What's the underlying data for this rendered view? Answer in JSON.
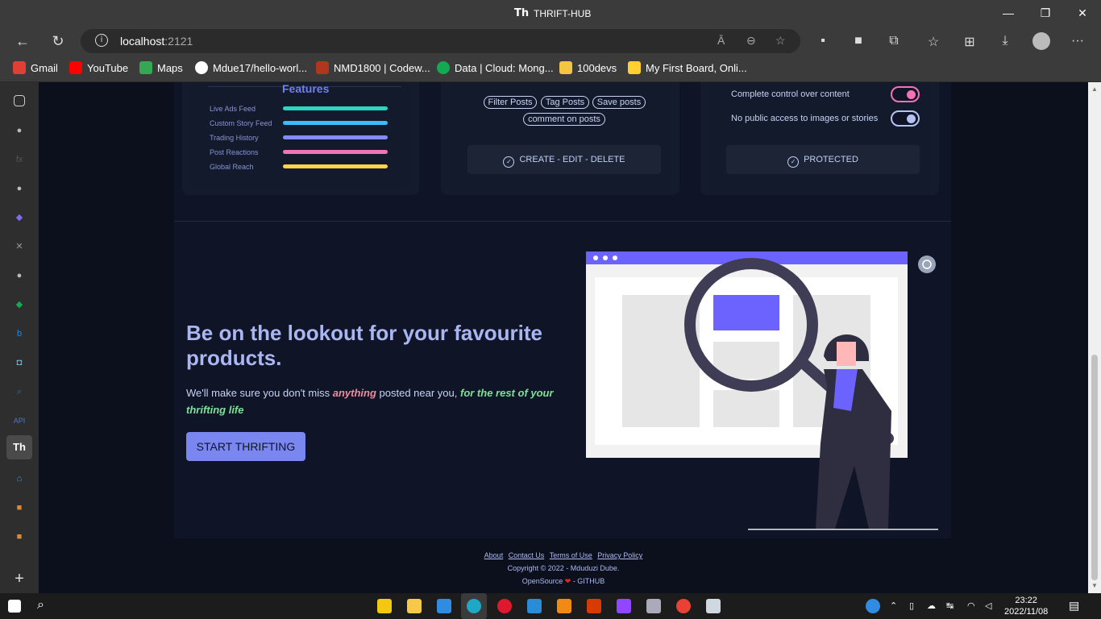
{
  "window": {
    "logo_text": "Th",
    "title": "THRIFT-HUB"
  },
  "controls": {
    "minimize": "—",
    "restore": "❐",
    "close": "✕"
  },
  "address": {
    "host": "localhost",
    "port": ":2121",
    "info_glyph": "i",
    "read_aloud_glyph": "Ā",
    "zoom_glyph": "⊖",
    "fav_glyph": "☆"
  },
  "nav": {
    "back_glyph": "←",
    "reload_glyph": "↻"
  },
  "toolbar": {
    "more_glyph": "···"
  },
  "bookmarks": [
    {
      "label": "Gmail",
      "color": "#e04033"
    },
    {
      "label": "YouTube",
      "color": "#f00"
    },
    {
      "label": "Maps",
      "color": "#34a853"
    },
    {
      "label": "Mdue17/hello-worl...",
      "color": "#ffffff"
    },
    {
      "label": "NMD1800 | Codew...",
      "color": "#b1361e"
    },
    {
      "label": "Data | Cloud: Mong...",
      "color": "#13aa52"
    },
    {
      "label": "100devs",
      "color": "#f4c542"
    },
    {
      "label": "My First Board, Onli...",
      "color": "#ffd02f"
    }
  ],
  "sidebar_icons": {
    "api": "API",
    "active": "Th",
    "add": "+"
  },
  "features": {
    "title": "Features",
    "items": [
      {
        "label": "Live Ads Feed",
        "color": "#2dd4bf"
      },
      {
        "label": "Custom Story Feed",
        "color": "#38bdf8"
      },
      {
        "label": "Trading History",
        "color": "#818cf8"
      },
      {
        "label": "Post Reactions",
        "color": "#f472b6"
      },
      {
        "label": "Global Reach",
        "color": "#fcd34d"
      }
    ]
  },
  "posts": {
    "pills": [
      "Filter Posts",
      "Tag Posts",
      "Save posts",
      "comment on posts"
    ],
    "button": "CREATE - EDIT - DELETE"
  },
  "privacy": {
    "toggle1": "Complete control over content",
    "toggle2": "No public access to images or stories",
    "button": "PROTECTED",
    "toggle1_color": "#f472b6",
    "toggle2_color": "#b6c3f2"
  },
  "hero": {
    "heading": "Be on the lookout for your favourite products.",
    "p1": "We'll make sure you don't miss ",
    "em1": "anything",
    "p2": " posted near you, ",
    "em2": "for the rest of your thrifting life",
    "cta": "START THRIFTING"
  },
  "footer": {
    "links": [
      "About",
      "Contact Us",
      "Terms of Use",
      "Privacy Policy"
    ],
    "copyright": "Copyright © 2022 - Mduduzi Dube.",
    "opensource": "OpenSource",
    "heart": "❤",
    "github": "- GITHUB"
  },
  "taskbar": {
    "time": "23:22",
    "date": "2022/11/08",
    "search_glyph": "⌕",
    "up_glyph": "⌃",
    "lang": "↹"
  }
}
